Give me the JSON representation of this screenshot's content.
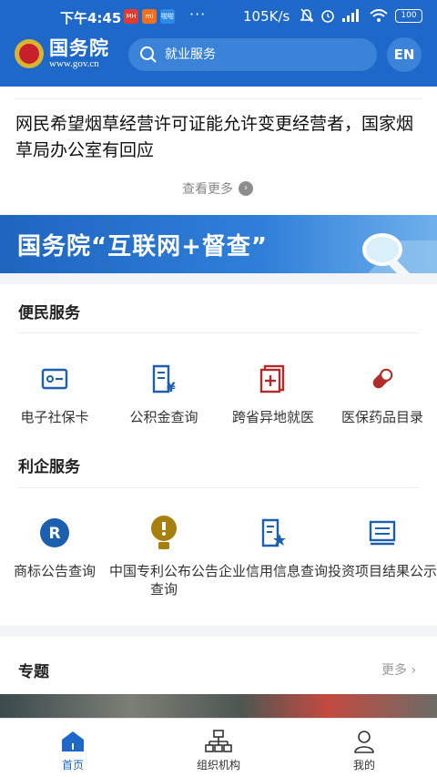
{
  "status_bar": {
    "time": "下午4:45",
    "app_badges": [
      {
        "name": "news-app-icon",
        "text": "MH",
        "color": "#e23b2f"
      },
      {
        "name": "mi-app-icon",
        "text": "mi",
        "color": "#f07021"
      },
      {
        "name": "app-icon",
        "text": "啦啦",
        "color": "#2d8ce8"
      }
    ],
    "more": "···",
    "net_speed": "105K/s",
    "battery": "100"
  },
  "header": {
    "title": "国务院",
    "subtitle": "www.gov.cn",
    "search_placeholder": "就业服务",
    "lang_button": "EN"
  },
  "news": {
    "headline": "网民希望烟草经营许可证能允许变更经营者，国家烟草局办公室有回应",
    "more_label": "查看更多"
  },
  "banner": {
    "text": "国务院“互联网+督查”"
  },
  "public_services": {
    "title": "便民服务",
    "items": [
      {
        "label": "电子社保卡",
        "icon": "id-card-icon"
      },
      {
        "label": "公积金查询",
        "icon": "fund-document-icon"
      },
      {
        "label": "跨省异地就医",
        "icon": "medical-cross-icon"
      },
      {
        "label": "医保药品目录",
        "icon": "capsule-icon"
      }
    ]
  },
  "business_services": {
    "title": "利企服务",
    "items": [
      {
        "label": "商标公告查询",
        "icon": "registered-mark-icon"
      },
      {
        "label": "中国专利公布公告查询",
        "icon": "bulb-icon"
      },
      {
        "label": "企业信用信息查询",
        "icon": "credit-document-icon"
      },
      {
        "label": "投资项目结果公示",
        "icon": "project-list-icon"
      }
    ]
  },
  "topics": {
    "title": "专题",
    "more": "更多"
  },
  "bottom_nav": [
    {
      "label": "首页",
      "icon": "home-icon",
      "active": true
    },
    {
      "label": "组织机构",
      "icon": "org-chart-icon",
      "active": false
    },
    {
      "label": "我的",
      "icon": "profile-icon",
      "active": false
    }
  ],
  "colors": {
    "brand_blue": "#1d68c9",
    "search_bg": "#3b83d9",
    "icon_blue": "#1b5fae",
    "icon_red": "#b22b2b",
    "icon_gold": "#a6800f"
  }
}
